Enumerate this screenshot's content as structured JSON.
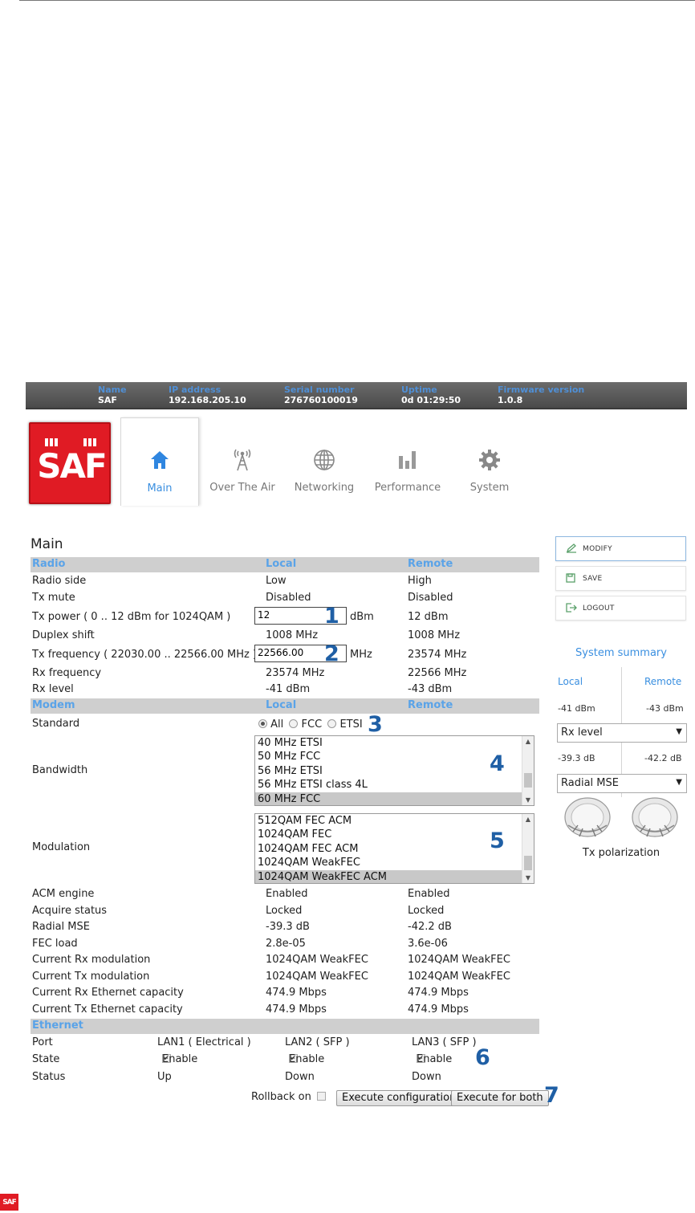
{
  "infobar": [
    {
      "label": "Name",
      "value": "SAF"
    },
    {
      "label": "IP address",
      "value": "192.168.205.10"
    },
    {
      "label": "Serial number",
      "value": "276760100019"
    },
    {
      "label": "Uptime",
      "value": "0d 01:29:50"
    },
    {
      "label": "Firmware version",
      "value": "1.0.8"
    }
  ],
  "logo": {
    "text": "SAF",
    "color": "#e01b24"
  },
  "tabs": [
    {
      "label": "Main",
      "icon": "home-icon",
      "active": true
    },
    {
      "label": "Over The Air",
      "icon": "antenna-tower-icon",
      "active": false
    },
    {
      "label": "Networking",
      "icon": "globe-icon",
      "active": false
    },
    {
      "label": "Performance",
      "icon": "bar-chart-icon",
      "active": false
    },
    {
      "label": "System",
      "icon": "gear-icon",
      "active": false
    }
  ],
  "page_title": "Main",
  "radio": {
    "header": {
      "section": "Radio",
      "local": "Local",
      "remote": "Remote"
    },
    "radio_side": {
      "label": "Radio side",
      "local": "Low",
      "remote": "High"
    },
    "tx_mute": {
      "label": "Tx mute",
      "local": "Disabled",
      "remote": "Disabled"
    },
    "tx_power": {
      "label": "Tx power ( 0 .. 12 dBm for 1024QAM )",
      "value": "12",
      "unit": "dBm",
      "remote": "12 dBm",
      "marker": "1"
    },
    "duplex_shift": {
      "label": "Duplex shift",
      "local": "1008 MHz",
      "remote": "1008 MHz"
    },
    "tx_frequency": {
      "label": "Tx frequency ( 22030.00 .. 22566.00 MHz )",
      "value": "22566.00",
      "unit": "MHz",
      "remote": "23574 MHz",
      "marker": "2"
    },
    "rx_frequency": {
      "label": "Rx frequency",
      "local": "23574 MHz",
      "remote": "22566 MHz"
    },
    "rx_level": {
      "label": "Rx level",
      "local": "-41 dBm",
      "remote": "-43 dBm"
    }
  },
  "modem": {
    "header": {
      "section": "Modem",
      "local": "Local",
      "remote": "Remote"
    },
    "standard": {
      "label": "Standard",
      "options": [
        "All",
        "FCC",
        "ETSI"
      ],
      "selected": "All",
      "marker": "3"
    },
    "bandwidth": {
      "label": "Bandwidth",
      "options": [
        "40 MHz ETSI",
        "50 MHz FCC",
        "56 MHz ETSI",
        "56 MHz ETSI class 4L",
        "60 MHz FCC"
      ],
      "selected": "60 MHz FCC",
      "marker": "4"
    },
    "modulation": {
      "label": "Modulation",
      "options": [
        "512QAM FEC ACM",
        "1024QAM FEC",
        "1024QAM FEC ACM",
        "1024QAM WeakFEC",
        "1024QAM WeakFEC ACM"
      ],
      "selected": "1024QAM WeakFEC ACM",
      "marker": "5"
    },
    "acm_engine": {
      "label": "ACM engine",
      "local": "Enabled",
      "remote": "Enabled"
    },
    "acquire_status": {
      "label": "Acquire status",
      "local": "Locked",
      "remote": "Locked"
    },
    "radial_mse": {
      "label": "Radial MSE",
      "local": "-39.3 dB",
      "remote": "-42.2 dB"
    },
    "fec_load": {
      "label": "FEC load",
      "local": "2.8e-05",
      "remote": "3.6e-06"
    },
    "cur_rx_mod": {
      "label": "Current Rx modulation",
      "local": "1024QAM WeakFEC",
      "remote": "1024QAM WeakFEC"
    },
    "cur_tx_mod": {
      "label": "Current Tx modulation",
      "local": "1024QAM WeakFEC",
      "remote": "1024QAM WeakFEC"
    },
    "cur_rx_eth": {
      "label": "Current Rx Ethernet capacity",
      "local": "474.9 Mbps",
      "remote": "474.9 Mbps"
    },
    "cur_tx_eth": {
      "label": "Current Tx Ethernet capacity",
      "local": "474.9 Mbps",
      "remote": "474.9 Mbps"
    }
  },
  "ethernet": {
    "header": {
      "section": "Ethernet"
    },
    "port": {
      "label": "Port",
      "lan1": "LAN1 ( Electrical )",
      "lan2": "LAN2 ( SFP )",
      "lan3": "LAN3 ( SFP )"
    },
    "state": {
      "label": "State",
      "enable": "Enable",
      "marker": "6"
    },
    "status": {
      "label": "Status",
      "lan1": "Up",
      "lan2": "Down",
      "lan3": "Down"
    }
  },
  "actions": {
    "rollback_label": "Rollback on",
    "execute_config": "Execute configuration",
    "execute_both": "Execute for both",
    "marker": "7"
  },
  "side": {
    "modify": "MODIFY",
    "save": "SAVE",
    "logout": "LOGOUT",
    "summary_title": "System summary",
    "local": "Local",
    "remote": "Remote",
    "local_rx": "-41 dBm",
    "remote_rx": "-43 dBm",
    "select1": "Rx level",
    "local_mse": "-39.3 dB",
    "remote_mse": "-42.2 dB",
    "select2": "Radial MSE",
    "tx_polarization": "Tx polarization"
  },
  "colors": {
    "accent": "#3a8fe0",
    "brand": "#e01b24",
    "marker": "#1f5fa5"
  }
}
